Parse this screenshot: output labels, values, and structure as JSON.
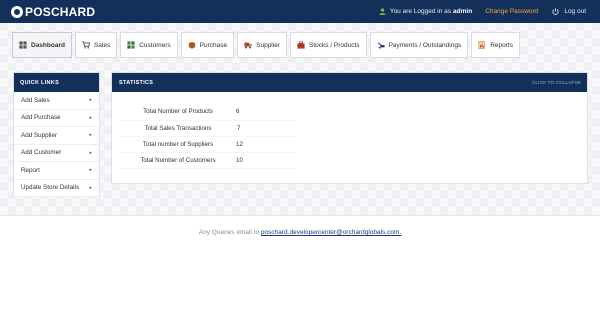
{
  "header": {
    "logo_text": "POSCHARD",
    "logged_in_prefix": "You are Logged in as",
    "username": "admin",
    "change_password": "Change Password",
    "logout": "Log out"
  },
  "tabs": [
    {
      "label": "Dashboard",
      "icon": "dashboard-icon",
      "active": true
    },
    {
      "label": "Sales",
      "icon": "cart-icon"
    },
    {
      "label": "Customers",
      "icon": "customers-icon"
    },
    {
      "label": "Purchase",
      "icon": "purchase-icon"
    },
    {
      "label": "Supplier",
      "icon": "supplier-icon"
    },
    {
      "label": "Stocks / Products",
      "icon": "stocks-icon"
    },
    {
      "label": "Payments / Outstandings",
      "icon": "payments-icon"
    },
    {
      "label": "Reports",
      "icon": "reports-icon"
    }
  ],
  "quick_links": {
    "title": "QUICK LINKS",
    "items": [
      {
        "label": "Add Sales"
      },
      {
        "label": "Add Purchase"
      },
      {
        "label": "Add Supplier"
      },
      {
        "label": "Add Customer"
      },
      {
        "label": "Report"
      },
      {
        "label": "Update Store Details"
      }
    ]
  },
  "statistics": {
    "title": "STATISTICS",
    "collapse_label": "CLICK TO COLLAPSE",
    "rows": [
      {
        "label": "Total Number of Products",
        "value": "6"
      },
      {
        "label": "Total Sales Transactions",
        "value": "7"
      },
      {
        "label": "Total number of Suppliers",
        "value": "12"
      },
      {
        "label": "Total Number of Customers",
        "value": "10"
      }
    ]
  },
  "footer": {
    "prefix": "Any Queries email to",
    "email": "poschard.developercenter@orchardglobals.com."
  },
  "colors": {
    "header_bg": "#13305a",
    "accent_link": "#f0a830",
    "user_icon": "#6cc04a"
  }
}
